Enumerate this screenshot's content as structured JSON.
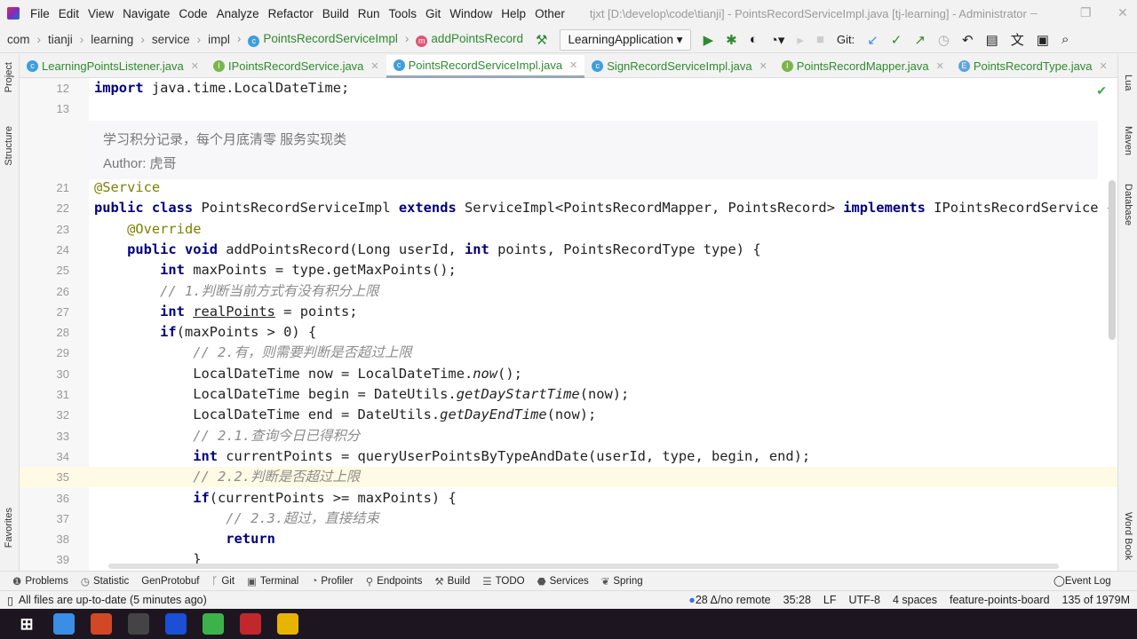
{
  "menu": [
    "File",
    "Edit",
    "View",
    "Navigate",
    "Code",
    "Analyze",
    "Refactor",
    "Build",
    "Run",
    "Tools",
    "Git",
    "Window",
    "Help",
    "Other"
  ],
  "window_title": "tjxt [D:\\develop\\code\\tianji] - PointsRecordServiceImpl.java [tj-learning] - Administrator",
  "breadcrumb": [
    "com",
    "tianji",
    "learning",
    "service",
    "impl"
  ],
  "breadcrumb_class": "PointsRecordServiceImpl",
  "breadcrumb_method": "addPointsRecord",
  "run_config": "LearningApplication",
  "git_label": "Git:",
  "tabs": [
    {
      "label": "LearningPointsListener.java",
      "icon": "c"
    },
    {
      "label": "IPointsRecordService.java",
      "icon": "i"
    },
    {
      "label": "PointsRecordServiceImpl.java",
      "icon": "c",
      "active": true
    },
    {
      "label": "SignRecordServiceImpl.java",
      "icon": "c"
    },
    {
      "label": "PointsRecordMapper.java",
      "icon": "i"
    },
    {
      "label": "PointsRecordType.java",
      "icon": "e"
    }
  ],
  "left_tools": [
    "Project",
    "Structure",
    "Favorites"
  ],
  "right_tools": [
    "Lua",
    "Maven",
    "Database",
    "Word Book"
  ],
  "doc_comment": {
    "text": "学习积分记录，每个月底清零 服务实现类",
    "author": "Author: 虎哥"
  },
  "code": [
    {
      "n": "12",
      "t": [
        [
          "kw",
          "import "
        ],
        [
          "",
          "java.time.LocalDateTime;"
        ]
      ]
    },
    {
      "n": "13",
      "t": []
    },
    {
      "n": "21",
      "t": [
        [
          "ann",
          "@Service"
        ]
      ]
    },
    {
      "n": "22",
      "t": [
        [
          "kw",
          "public class "
        ],
        [
          "",
          "PointsRecordServiceImpl "
        ],
        [
          "kw",
          "extends "
        ],
        [
          "",
          "ServiceImpl<PointsRecordMapper, PointsRecord> "
        ],
        [
          "kw",
          "implements "
        ],
        [
          "",
          "IPointsRecordService {"
        ]
      ]
    },
    {
      "n": "23",
      "t": [
        [
          "",
          "    "
        ],
        [
          "ann",
          "@Override"
        ]
      ]
    },
    {
      "n": "24",
      "t": [
        [
          "",
          "    "
        ],
        [
          "kw",
          "public void "
        ],
        [
          "",
          "addPointsRecord(Long userId, "
        ],
        [
          "kw",
          "int "
        ],
        [
          "",
          "points, PointsRecordType type) {"
        ]
      ]
    },
    {
      "n": "25",
      "t": [
        [
          "",
          "        "
        ],
        [
          "kw",
          "int "
        ],
        [
          "",
          "maxPoints = type.getMaxPoints();"
        ]
      ]
    },
    {
      "n": "26",
      "t": [
        [
          "",
          "        "
        ],
        [
          "cm",
          "// 1.判断当前方式有没有积分上限"
        ]
      ]
    },
    {
      "n": "27",
      "t": [
        [
          "",
          "        "
        ],
        [
          "kw",
          "int "
        ],
        [
          "ul",
          "realPoints"
        ],
        [
          "",
          " = points;"
        ]
      ]
    },
    {
      "n": "28",
      "t": [
        [
          "",
          "        "
        ],
        [
          "kw",
          "if"
        ],
        [
          "",
          "(maxPoints > 0) {"
        ]
      ]
    },
    {
      "n": "29",
      "t": [
        [
          "",
          "            "
        ],
        [
          "cm",
          "// 2.有，则需要判断是否超过上限"
        ]
      ]
    },
    {
      "n": "30",
      "t": [
        [
          "",
          "            LocalDateTime now = LocalDateTime."
        ],
        [
          "it",
          "now"
        ],
        [
          "",
          "();"
        ]
      ]
    },
    {
      "n": "31",
      "t": [
        [
          "",
          "            LocalDateTime begin = DateUtils."
        ],
        [
          "it",
          "getDayStartTime"
        ],
        [
          "",
          "(now);"
        ]
      ]
    },
    {
      "n": "32",
      "t": [
        [
          "",
          "            LocalDateTime end = DateUtils."
        ],
        [
          "it",
          "getDayEndTime"
        ],
        [
          "",
          "(now);"
        ]
      ]
    },
    {
      "n": "33",
      "t": [
        [
          "",
          "            "
        ],
        [
          "cm",
          "// 2.1.查询今日已得积分"
        ]
      ]
    },
    {
      "n": "34",
      "t": [
        [
          "",
          "            "
        ],
        [
          "kw",
          "int "
        ],
        [
          "",
          "currentPoints = queryUserPointsByTypeAndDate(userId, type, begin, end);"
        ]
      ]
    },
    {
      "n": "35",
      "t": [
        [
          "",
          "            "
        ],
        [
          "cm",
          "// 2.2.判断是否超过上限"
        ]
      ],
      "current": true
    },
    {
      "n": "36",
      "t": [
        [
          "",
          "            "
        ],
        [
          "kw",
          "if"
        ],
        [
          "",
          "(currentPoints >= maxPoints) {"
        ]
      ]
    },
    {
      "n": "37",
      "t": [
        [
          "",
          "                "
        ],
        [
          "cm",
          "// 2.3.超过，直接结束"
        ]
      ]
    },
    {
      "n": "38",
      "t": [
        [
          "",
          "                "
        ],
        [
          "kw",
          "return"
        ],
        [
          ";"
        ]
      ]
    },
    {
      "n": "39",
      "t": [
        [
          "",
          "            }"
        ]
      ]
    }
  ],
  "tool_windows": [
    "Problems",
    "Statistic",
    "GenProtobuf",
    "Git",
    "Terminal",
    "Profiler",
    "Endpoints",
    "Build",
    "TODO",
    "Services",
    "Spring"
  ],
  "event_log": "Event Log",
  "status": {
    "message": "All files are up-to-date (5 minutes ago)",
    "git": "28 Δ/no remote",
    "position": "35:28",
    "line_sep": "LF",
    "encoding": "UTF-8",
    "indent": "4 spaces",
    "branch": "feature-points-board",
    "memory": "135 of 1979M"
  },
  "taskbar": [
    "Start",
    "Explorer",
    "PowerPoint",
    "Terminal",
    "IntelliJ IDEA",
    "HBuilder",
    "Redis",
    "Chrome"
  ]
}
